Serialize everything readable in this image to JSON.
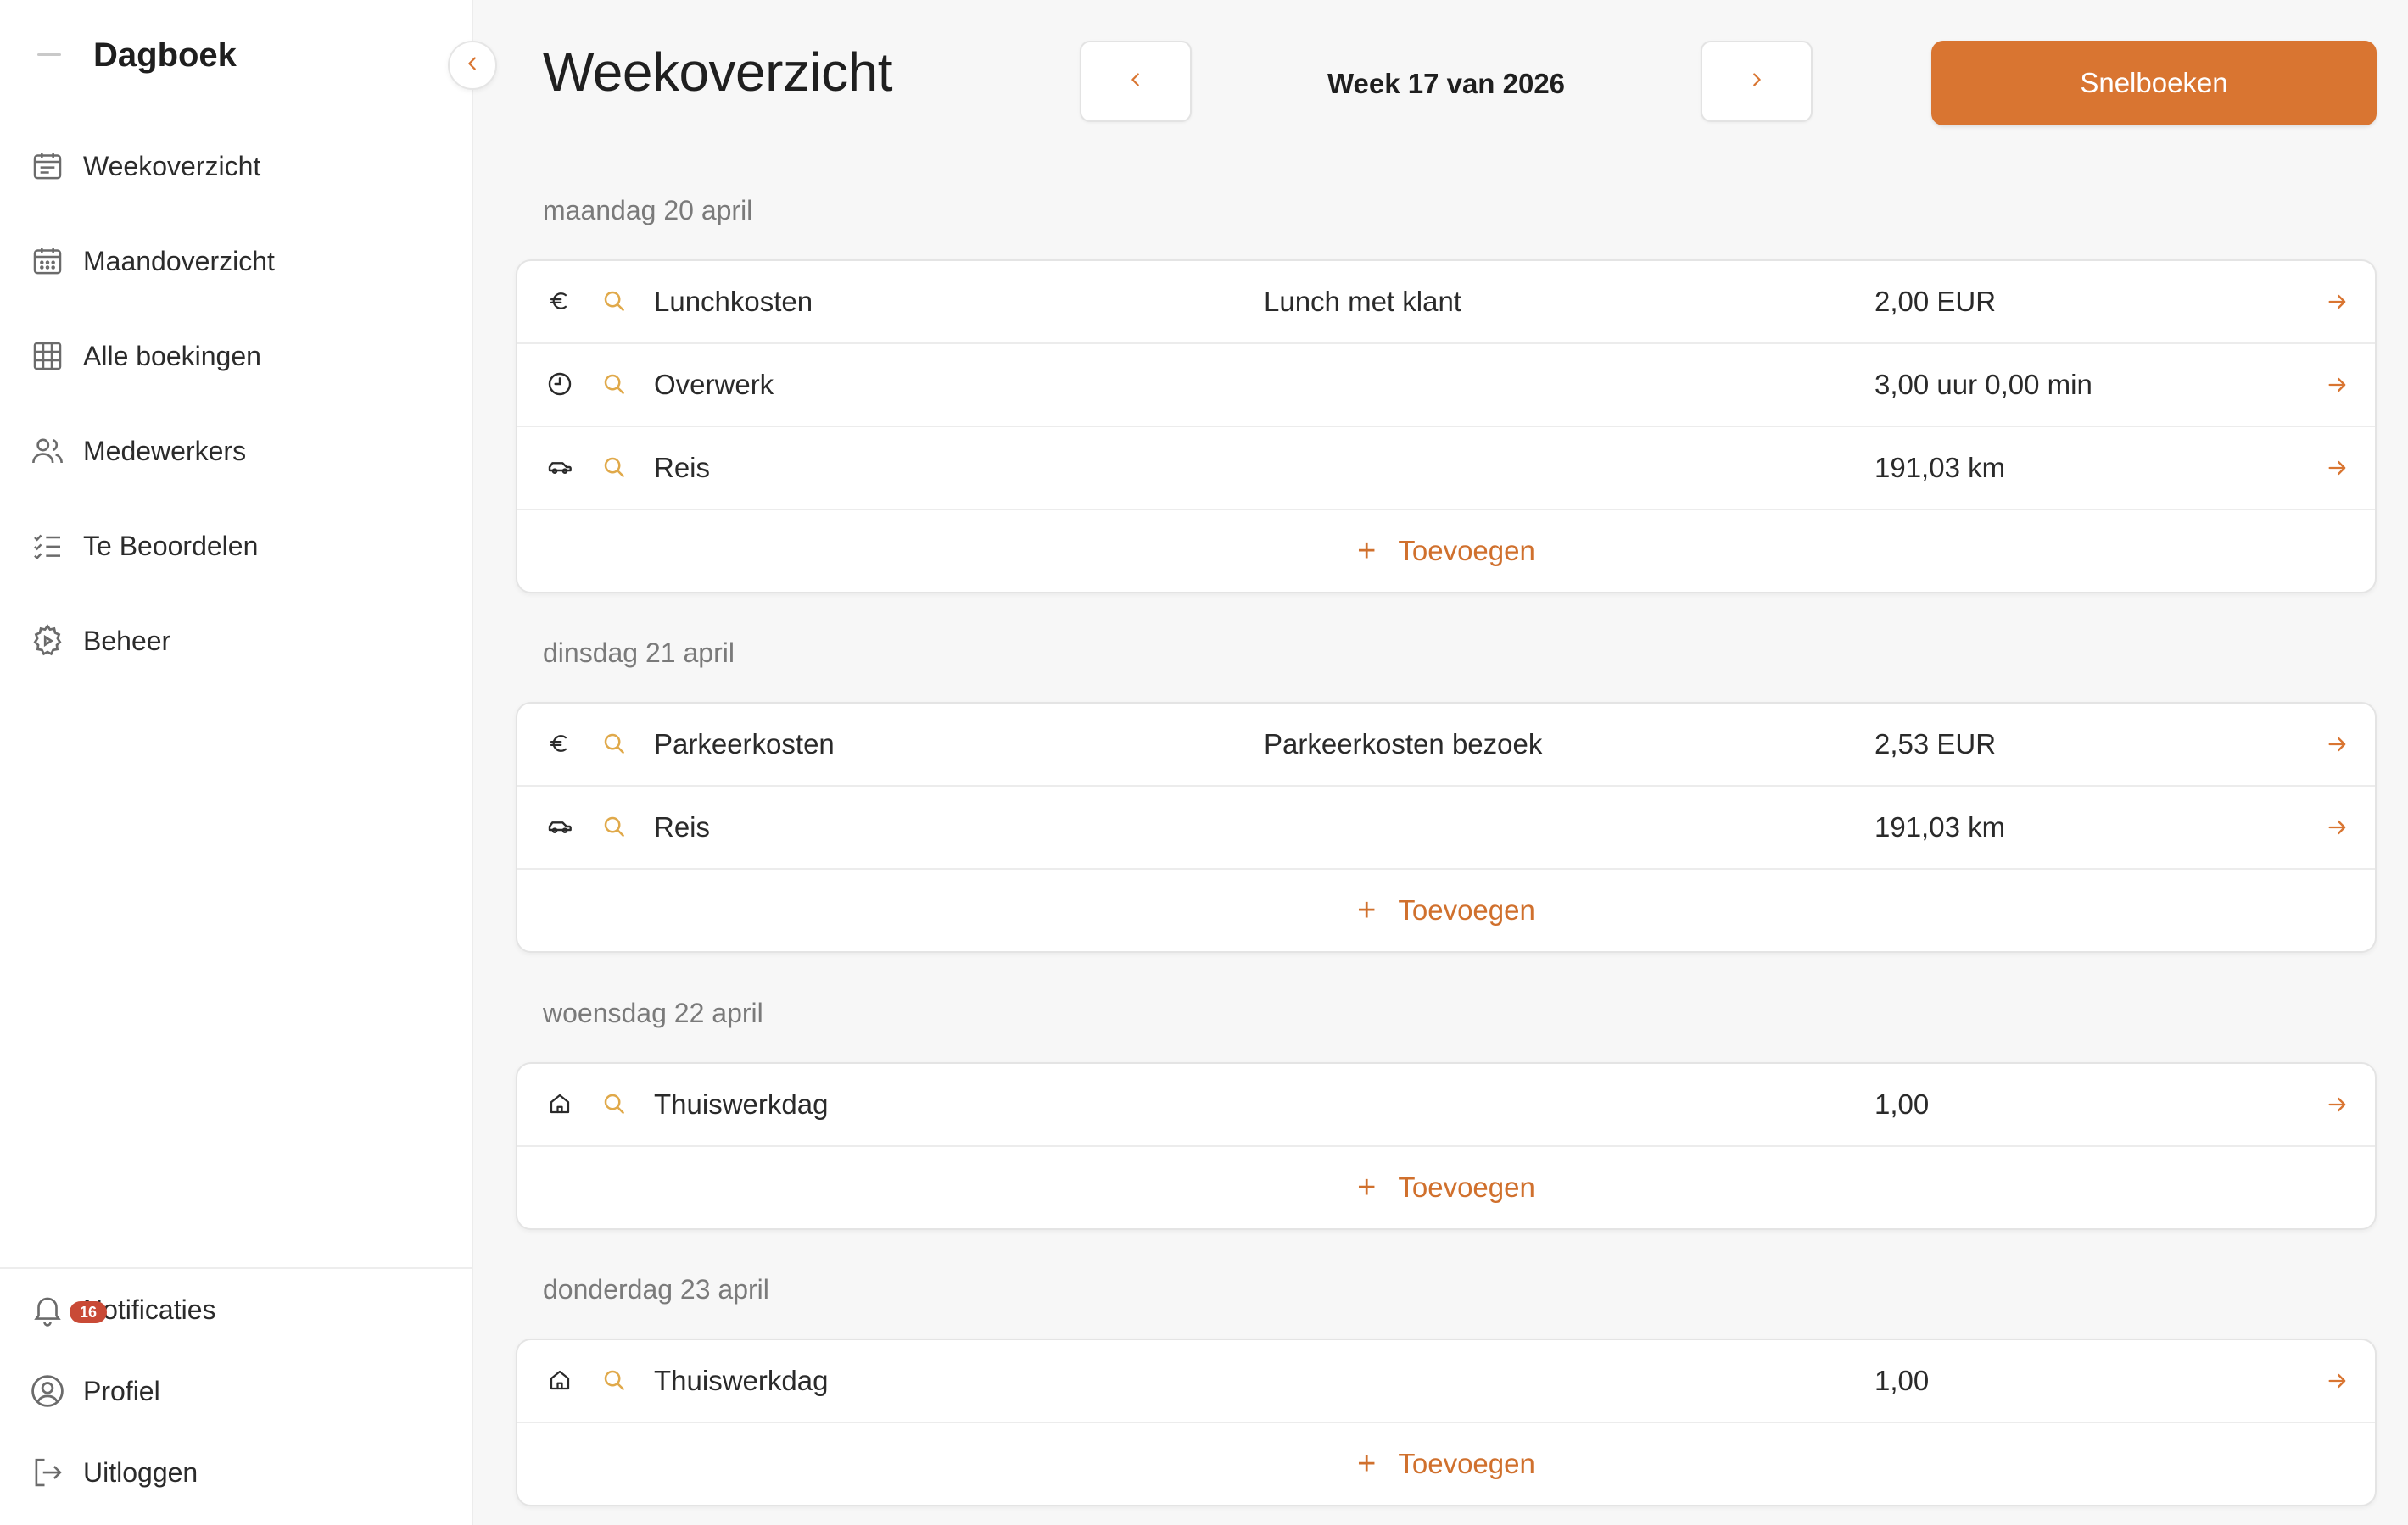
{
  "app": {
    "title": "Dagboek"
  },
  "sidebar": {
    "items": [
      {
        "label": "Weekoverzicht",
        "icon": "calendar-week-icon"
      },
      {
        "label": "Maandoverzicht",
        "icon": "calendar-month-icon"
      },
      {
        "label": "Alle boekingen",
        "icon": "grid-icon"
      },
      {
        "label": "Medewerkers",
        "icon": "users-icon"
      },
      {
        "label": "Te Beoordelen",
        "icon": "checklist-icon"
      },
      {
        "label": "Beheer",
        "icon": "gear-icon"
      }
    ],
    "bottom": [
      {
        "label": "Notificaties",
        "icon": "bell-icon",
        "badge": "16"
      },
      {
        "label": "Profiel",
        "icon": "user-circle-icon"
      },
      {
        "label": "Uitloggen",
        "icon": "logout-icon"
      }
    ]
  },
  "header": {
    "title": "Weekoverzicht",
    "week_label": "Week 17 van 2026",
    "quick_book_label": "Snelboeken"
  },
  "days": [
    {
      "label": "maandag 20 april",
      "rows": [
        {
          "icon": "euro-icon",
          "category": "Lunchkosten",
          "description": "Lunch met klant",
          "value": "2,00 EUR"
        },
        {
          "icon": "clock-icon",
          "category": "Overwerk",
          "description": "",
          "value": "3,00 uur 0,00 min"
        },
        {
          "icon": "car-icon",
          "category": "Reis",
          "description": "",
          "value": "191,03 km"
        }
      ],
      "add_label": "Toevoegen"
    },
    {
      "label": "dinsdag 21 april",
      "rows": [
        {
          "icon": "euro-icon",
          "category": "Parkeerkosten",
          "description": "Parkeerkosten bezoek",
          "value": "2,53 EUR"
        },
        {
          "icon": "car-icon",
          "category": "Reis",
          "description": "",
          "value": "191,03 km"
        }
      ],
      "add_label": "Toevoegen"
    },
    {
      "label": "woensdag 22 april",
      "rows": [
        {
          "icon": "home-icon",
          "category": "Thuiswerkdag",
          "description": "",
          "value": "1,00"
        }
      ],
      "add_label": "Toevoegen"
    },
    {
      "label": "donderdag 23 april",
      "rows": [
        {
          "icon": "home-icon",
          "category": "Thuiswerkdag",
          "description": "",
          "value": "1,00"
        }
      ],
      "add_label": "Toevoegen"
    }
  ],
  "colors": {
    "accent": "#d97531",
    "search_icon": "#e0a94a",
    "badge": "#c94a36"
  }
}
